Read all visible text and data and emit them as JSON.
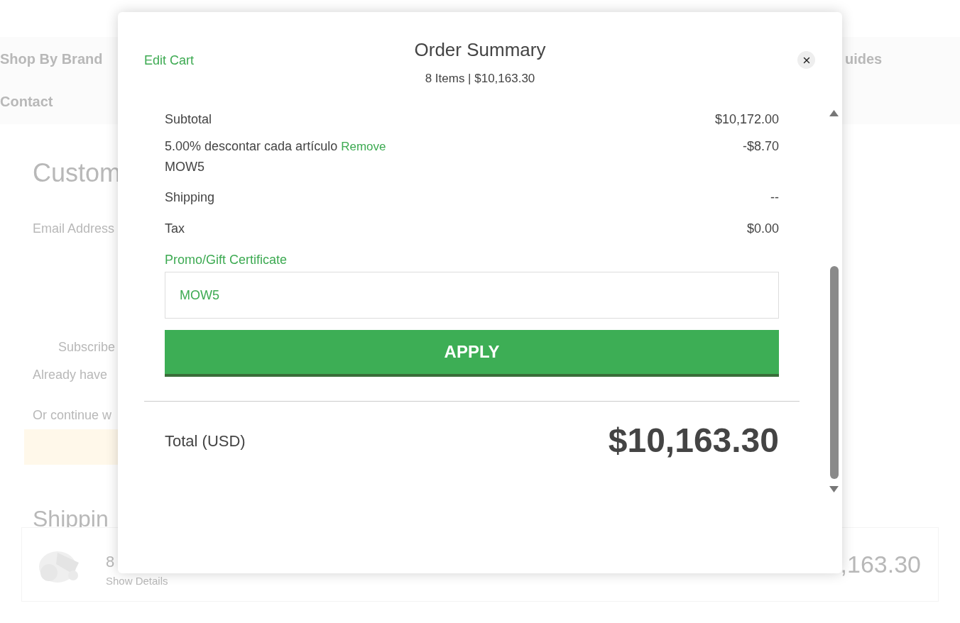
{
  "background": {
    "nav": {
      "items": [
        "Shop By Brand",
        "Contact"
      ],
      "right_item": "uides"
    },
    "heading": "Custom",
    "email_label": "Email Address",
    "subscribe": "Subscribe",
    "already": "Already have",
    "continue": "Or continue w",
    "shipping_heading": "Shippin",
    "cart_card": {
      "count": "8",
      "details_link": "Show Details",
      "total": ",163.30"
    }
  },
  "modal": {
    "edit_cart": "Edit Cart",
    "title": "Order Summary",
    "subtitle": "8 Items | $10,163.30",
    "lines": [
      {
        "kind": "plain",
        "label": "Subtotal",
        "value": "$10,172.00"
      },
      {
        "kind": "discount",
        "label": "5.00% descontar cada artículo",
        "action": "Remove",
        "code": "MOW5",
        "value": "-$8.70"
      },
      {
        "kind": "plain",
        "label": "Shipping",
        "value": "--"
      },
      {
        "kind": "plain",
        "label": "Tax",
        "value": "$0.00"
      }
    ],
    "promo_label": "Promo/Gift Certificate",
    "promo_value": "MOW5",
    "apply": "APPLY",
    "total_label": "Total (USD)",
    "total_value": "$10,163.30"
  }
}
